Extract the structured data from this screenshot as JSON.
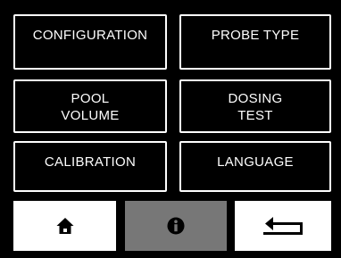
{
  "menu": {
    "configuration": [
      "CONFIGURATION"
    ],
    "probe_type": [
      "PROBE TYPE"
    ],
    "pool_volume": [
      "POOL",
      "VOLUME"
    ],
    "dosing_test": [
      "DOSING",
      "TEST"
    ],
    "calibration": [
      "CALIBRATION"
    ],
    "language": [
      "LANGUAGE"
    ]
  },
  "nav": {
    "home_icon": "home-icon",
    "info_icon": "info-icon",
    "back_icon": "back-arrow-icon"
  },
  "colors": {
    "background": "#000000",
    "button_border": "#ffffff",
    "button_text": "#ffffff",
    "nav_light": "#ffffff",
    "nav_active": "#777777",
    "icon": "#000000"
  }
}
